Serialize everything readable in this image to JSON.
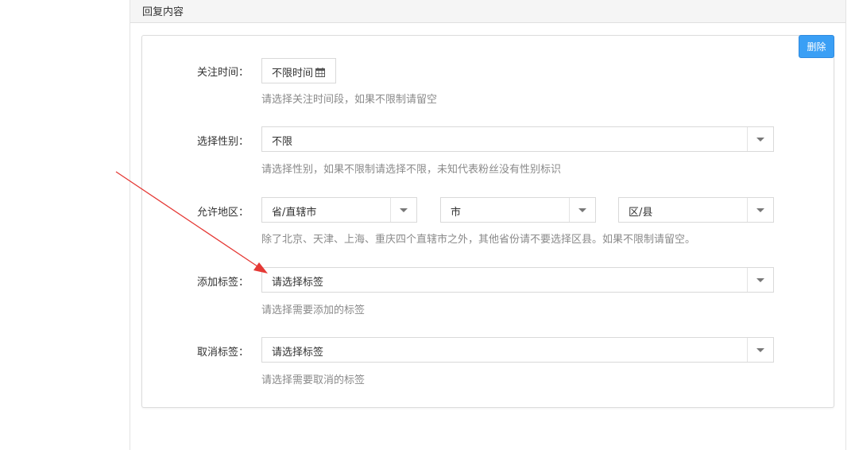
{
  "panel": {
    "title": "回复内容"
  },
  "actions": {
    "delete_label": "删除"
  },
  "form": {
    "follow_time": {
      "label": "关注时间：",
      "value": "不限时间",
      "help": "请选择关注时间段，如果不限制请留空"
    },
    "gender": {
      "label": "选择性别：",
      "value": "不限",
      "help": "请选择性别，如果不限制请选择不限，未知代表粉丝没有性别标识"
    },
    "region": {
      "label": "允许地区：",
      "province": "省/直辖市",
      "city": "市",
      "district": "区/县",
      "help": "除了北京、天津、上海、重庆四个直辖市之外，其他省份请不要选择区县。如果不限制请留空。"
    },
    "add_tag": {
      "label": "添加标签：",
      "value": "请选择标签",
      "help": "请选择需要添加的标签"
    },
    "remove_tag": {
      "label": "取消标签：",
      "value": "请选择标签",
      "help": "请选择需要取消的标签"
    }
  },
  "colors": {
    "primary": "#3a9ff5",
    "annotation_arrow": "#e53935",
    "help_text": "#8a8a8a"
  },
  "icons": {
    "calendar": "calendar-icon",
    "dropdown": "chevron-down-icon"
  }
}
